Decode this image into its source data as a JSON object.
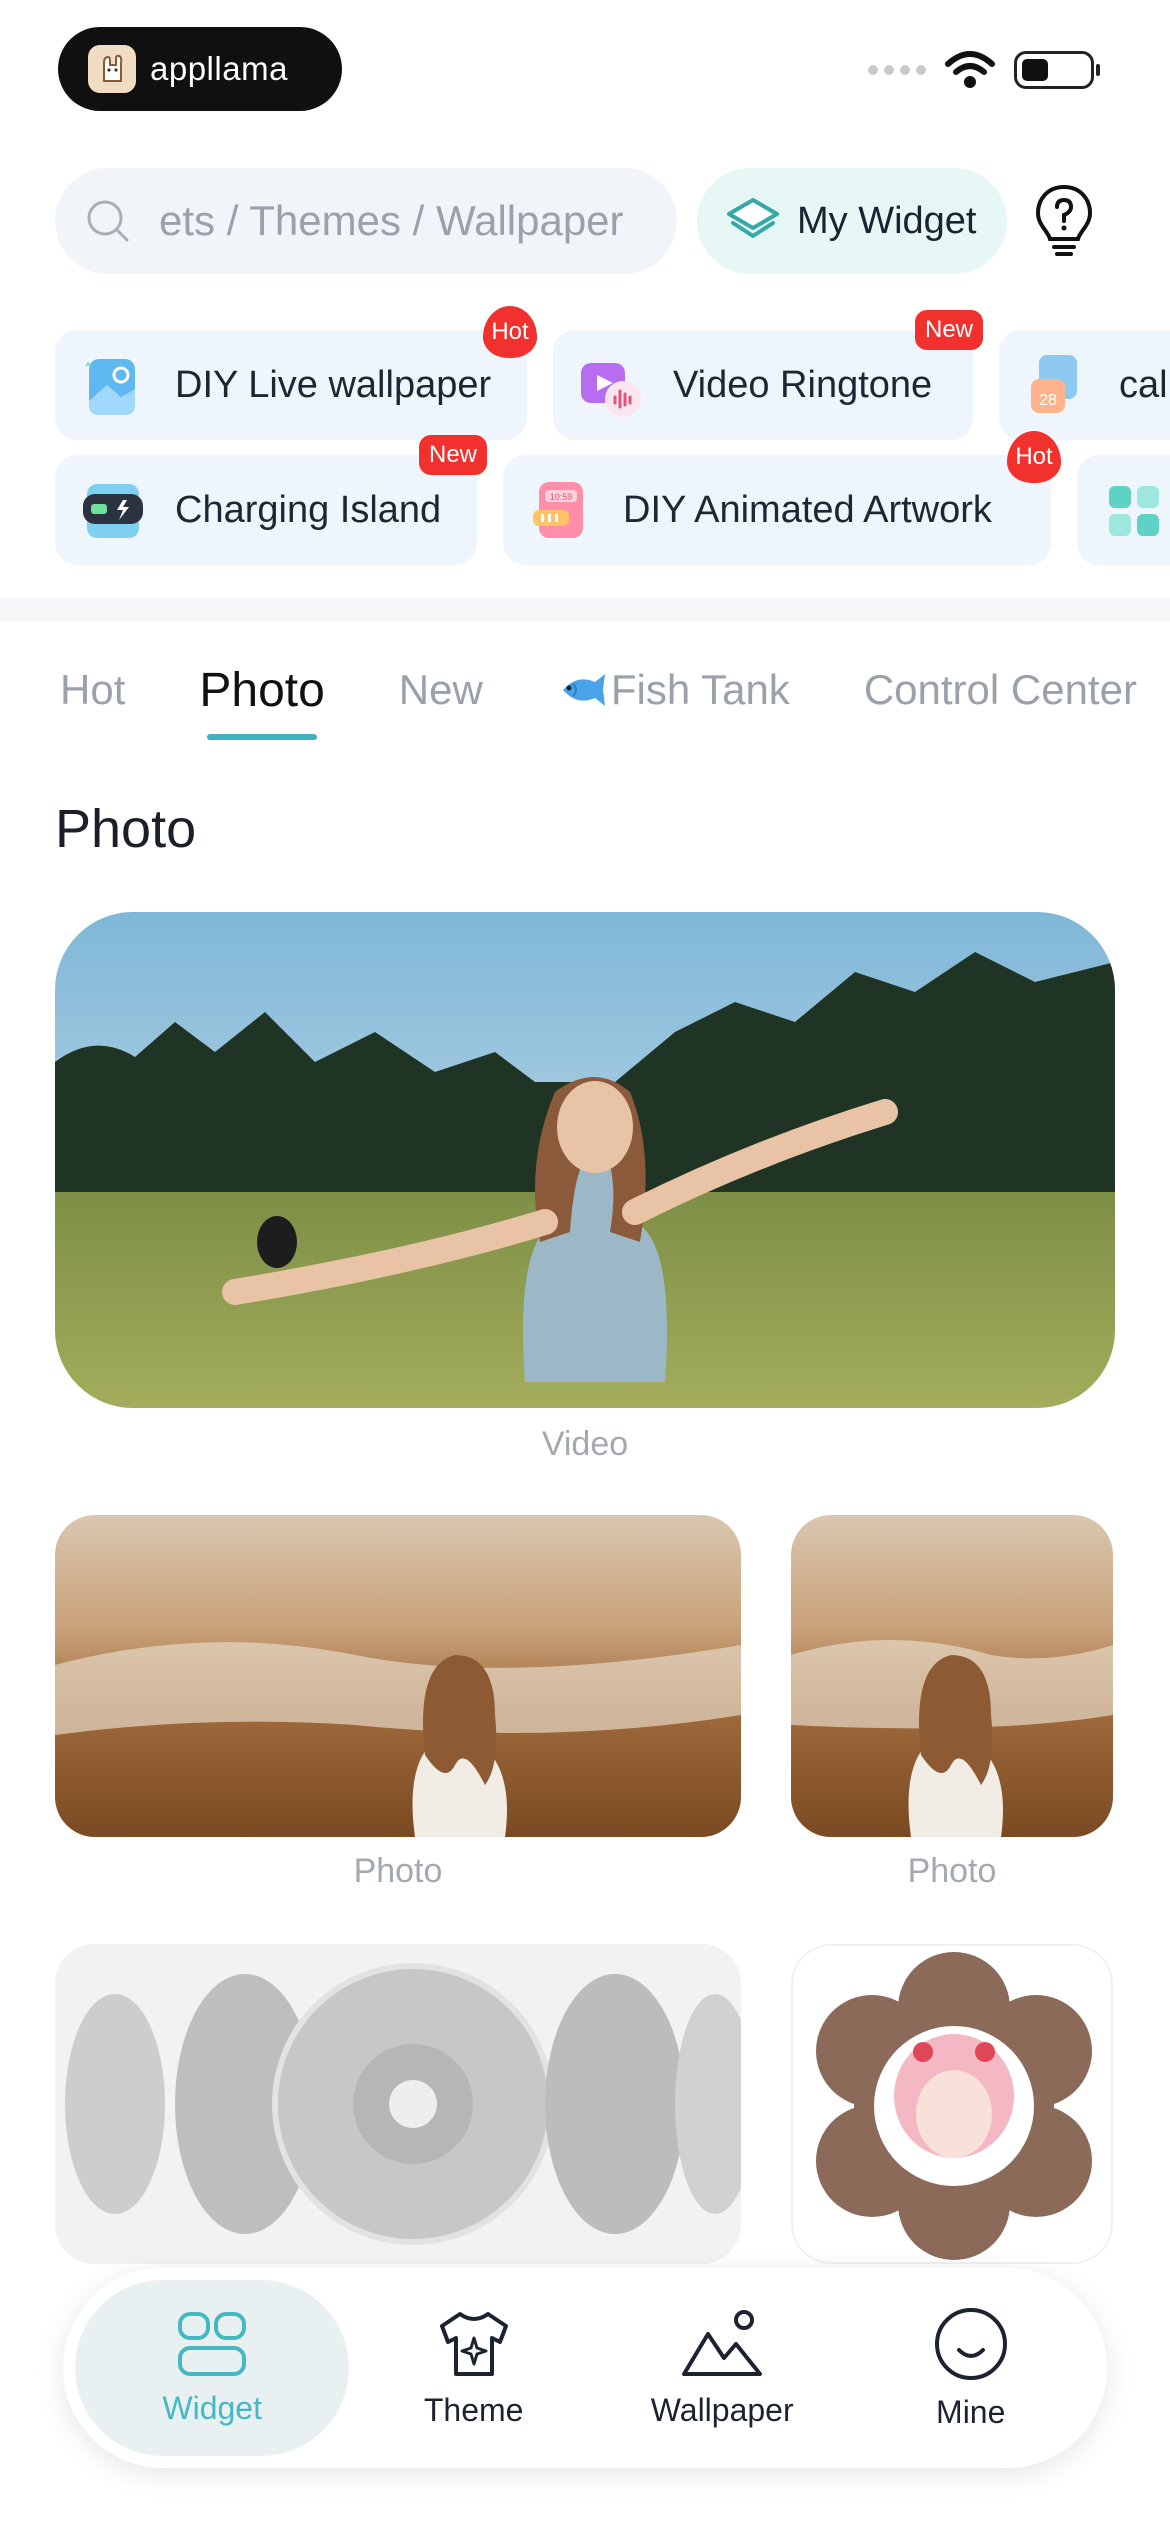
{
  "status_bar": {
    "brand_name": "appllama",
    "icons": [
      "signal-dots-icon",
      "wifi-icon",
      "battery-icon"
    ]
  },
  "search": {
    "placeholder": "ets / Themes / Wallpaper",
    "icon": "search-icon"
  },
  "my_widget": {
    "label": "My Widget",
    "icon": "layers-icon"
  },
  "help": {
    "icon": "lightbulb-help-icon"
  },
  "features": {
    "row1": [
      {
        "label": "DIY Live wallpaper",
        "badge": "Hot"
      },
      {
        "label": "Video Ringtone",
        "badge": "New"
      },
      {
        "label": "cal",
        "badge": ""
      }
    ],
    "row2": [
      {
        "label": "Charging Island",
        "badge": "New"
      },
      {
        "label": "DIY Animated Artwork",
        "badge": "Hot"
      }
    ],
    "calendar_number": "28",
    "clock_time": "10:59"
  },
  "tabs": [
    "Hot",
    "Photo",
    "New",
    "Fish Tank",
    "Control Center"
  ],
  "active_tab": "Photo",
  "section_title": "Photo",
  "cards": {
    "video_caption": "Video",
    "photo_caption_1": "Photo",
    "photo_caption_2": "Photo"
  },
  "bottom_nav": [
    {
      "label": "Widget",
      "icon": "widget-grid-icon",
      "active": true
    },
    {
      "label": "Theme",
      "icon": "shirt-sparkle-icon",
      "active": false
    },
    {
      "label": "Wallpaper",
      "icon": "mountain-icon",
      "active": false
    },
    {
      "label": "Mine",
      "icon": "smile-face-icon",
      "active": false
    }
  ],
  "colors": {
    "accent": "#3fb3bd",
    "badge_red": "#f0312d",
    "chip_bg": "#eef5fc",
    "my_widget_bg": "#e6f7f5"
  }
}
